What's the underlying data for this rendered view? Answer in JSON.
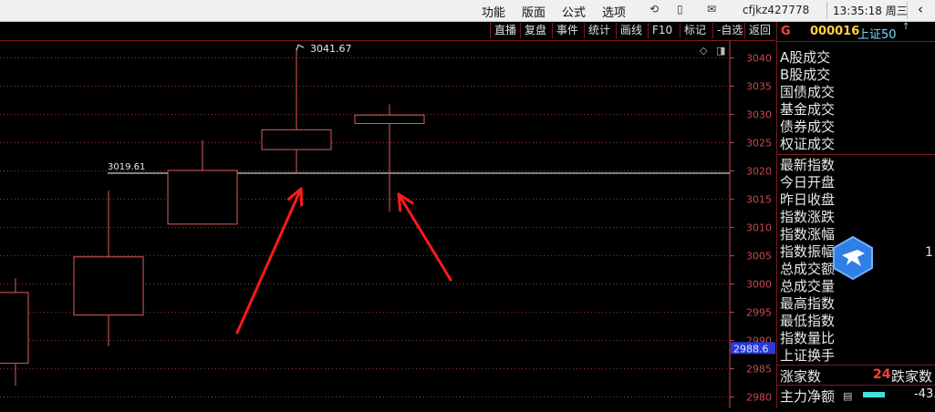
{
  "menu": {
    "items": [
      "功能",
      "版面",
      "公式",
      "选项"
    ],
    "user": "cfjkz427778",
    "time": "13:35:18 周三"
  },
  "toolbar": {
    "buttons": [
      "直播",
      "复盘",
      "事件",
      "统计",
      "画线",
      "F10",
      "-自选",
      "标记",
      "返回"
    ]
  },
  "chart_data": {
    "type": "candlestick",
    "ylim": [
      2978,
      3043
    ],
    "y_ticks": [
      3040,
      3035,
      3030,
      3025,
      3020,
      3015,
      3010,
      3005,
      3000,
      2995,
      2990,
      2985,
      2980
    ],
    "current_price_label": "2988.6",
    "hline": {
      "value": 3019.61,
      "label": "3019.61"
    },
    "max_annotation": {
      "value": 3041.67,
      "label": "3041.67"
    },
    "candles": [
      {
        "open": 2986.0,
        "close": 2998.5,
        "high": 3001.0,
        "low": 2982.0
      },
      {
        "open": 2994.5,
        "close": 3004.8,
        "high": 3016.5,
        "low": 2989.0
      },
      {
        "open": 3010.6,
        "close": 3020.1,
        "high": 3025.5,
        "low": 3010.6
      },
      {
        "open": 3023.8,
        "close": 3027.3,
        "high": 3041.67,
        "low": 3019.6
      },
      {
        "open": 3028.4,
        "close": 3029.9,
        "high": 3031.8,
        "low": 3012.8
      }
    ],
    "colors": {
      "candle": "#e05a5a",
      "arrow": "#ff1a1a",
      "hline": "#ffffff",
      "axis": "#c84a4a"
    }
  },
  "right_panel": {
    "g": "G",
    "code": "000016",
    "name": "上证50",
    "sup": "↑",
    "labels_top": [
      "A股成交",
      "B股成交",
      "国债成交",
      "基金成交",
      "债券成交",
      "权证成交"
    ],
    "labels_mid": [
      "最新指数",
      "今日开盘",
      "昨日收盘",
      "指数涨跌",
      "指数涨幅",
      "指数振幅",
      "总成交额",
      "总成交量",
      "最高指数",
      "最低指数",
      "指数量比",
      "上证换手"
    ],
    "value_cut": "1",
    "up_label": "涨家数",
    "up_count": "24",
    "down_label": "跌家数",
    "main_label": "主力净额",
    "main_value": "-43."
  }
}
